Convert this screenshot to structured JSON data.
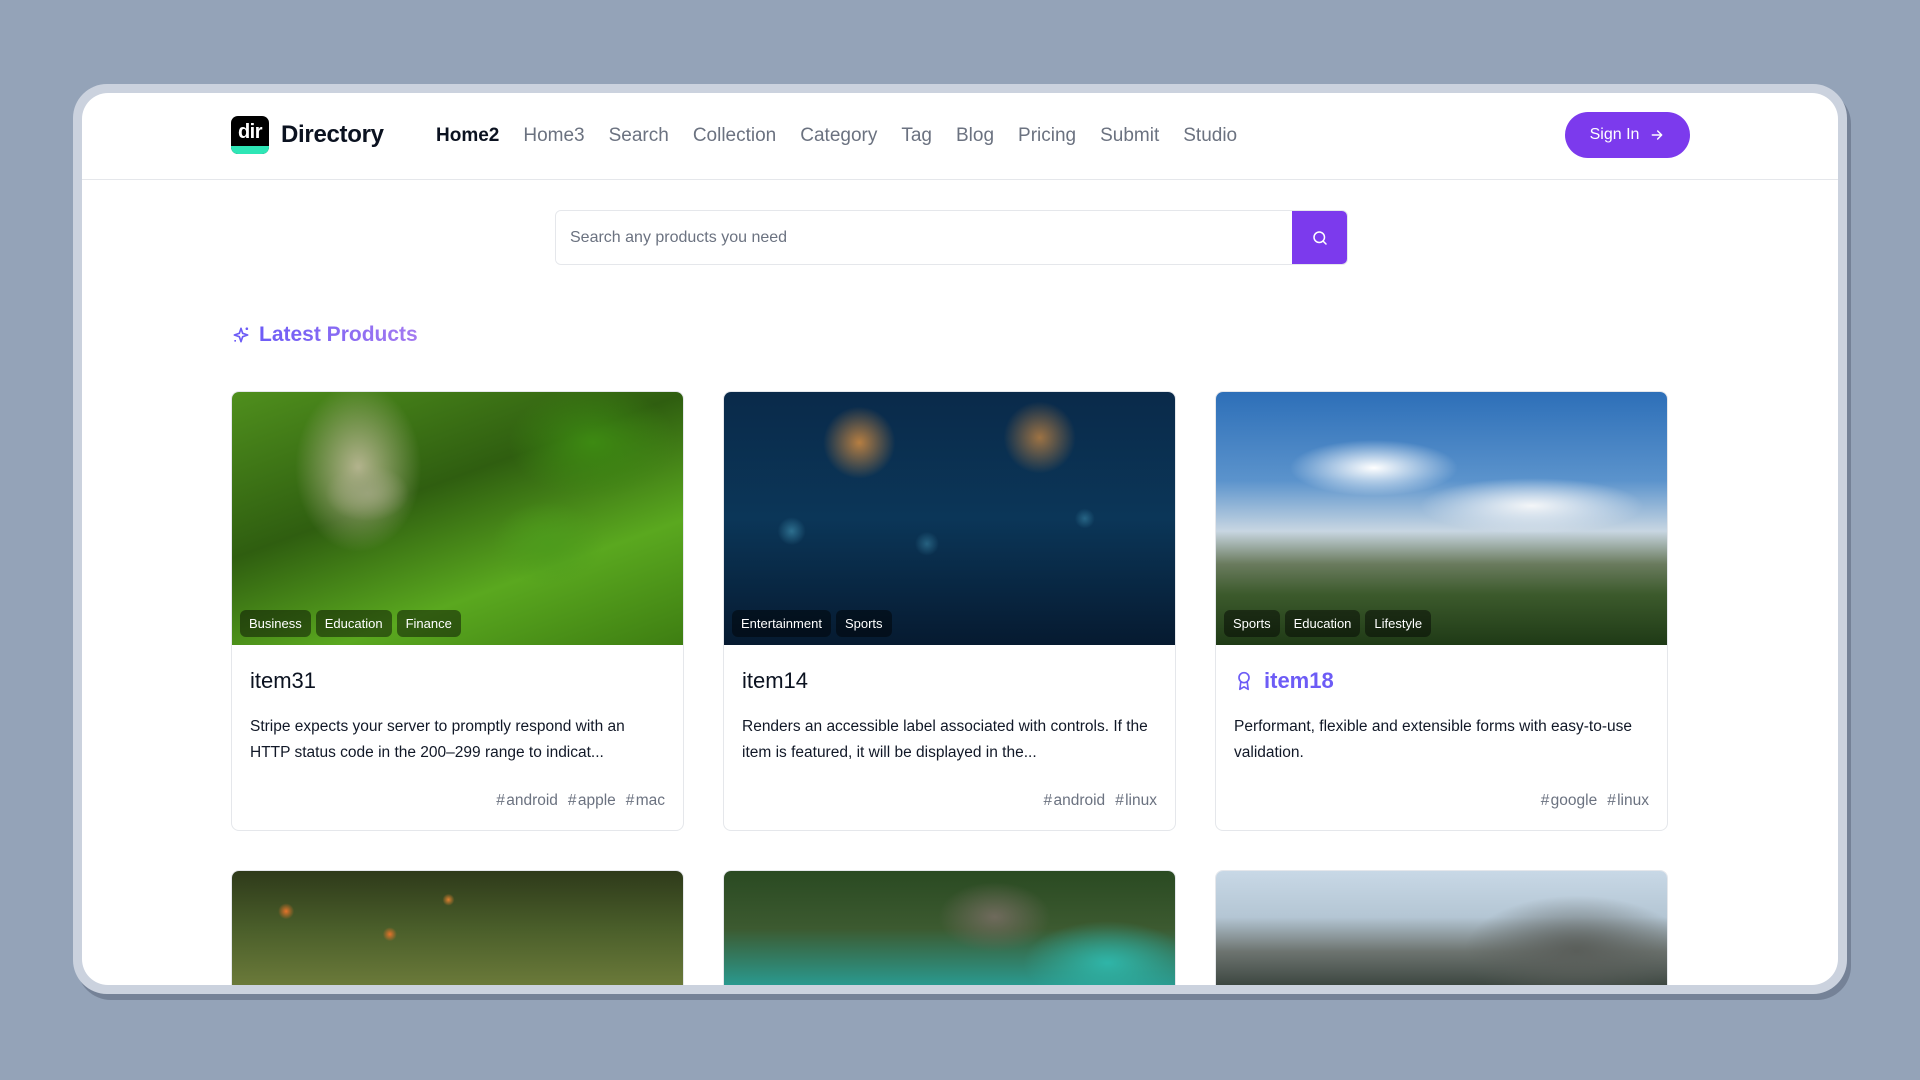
{
  "brand": {
    "logo_text": "dir",
    "name": "Directory"
  },
  "nav": {
    "items": [
      {
        "label": "Home2",
        "active": true
      },
      {
        "label": "Home3",
        "active": false
      },
      {
        "label": "Search",
        "active": false
      },
      {
        "label": "Collection",
        "active": false
      },
      {
        "label": "Category",
        "active": false
      },
      {
        "label": "Tag",
        "active": false
      },
      {
        "label": "Blog",
        "active": false
      },
      {
        "label": "Pricing",
        "active": false
      },
      {
        "label": "Submit",
        "active": false
      },
      {
        "label": "Studio",
        "active": false
      }
    ],
    "signin_label": "Sign In",
    "signin_icon": "arrow-right-icon"
  },
  "search": {
    "placeholder": "Search any products you need",
    "value": "",
    "button_icon": "search-icon"
  },
  "section": {
    "title": "Latest Products",
    "icon": "sparkles-icon"
  },
  "colors": {
    "accent": "#7c3aed",
    "featured": "#6d5cf6",
    "muted": "#6b7280"
  },
  "products": [
    {
      "title": "item31",
      "featured": false,
      "categories": [
        "Business",
        "Education",
        "Finance"
      ],
      "description": "Stripe expects your server to promptly respond with an HTTP status code in the 200–299 range to indicat...",
      "tags": [
        "android",
        "apple",
        "mac"
      ],
      "image": "aerial-forest-river"
    },
    {
      "title": "item14",
      "featured": false,
      "categories": [
        "Entertainment",
        "Sports"
      ],
      "description": "Renders an accessible label associated with controls. If the item is featured, it will be displayed in the...",
      "tags": [
        "android",
        "linux"
      ],
      "image": "sparklers-night"
    },
    {
      "title": "item18",
      "featured": true,
      "categories": [
        "Sports",
        "Education",
        "Lifestyle"
      ],
      "description": "Performant, flexible and extensible forms with easy-to-use validation.",
      "tags": [
        "google",
        "linux"
      ],
      "image": "mountain-sky-clouds"
    }
  ],
  "more_products_images": [
    "orange-tree",
    "lagoon-rocks",
    "cliff-landscape"
  ]
}
